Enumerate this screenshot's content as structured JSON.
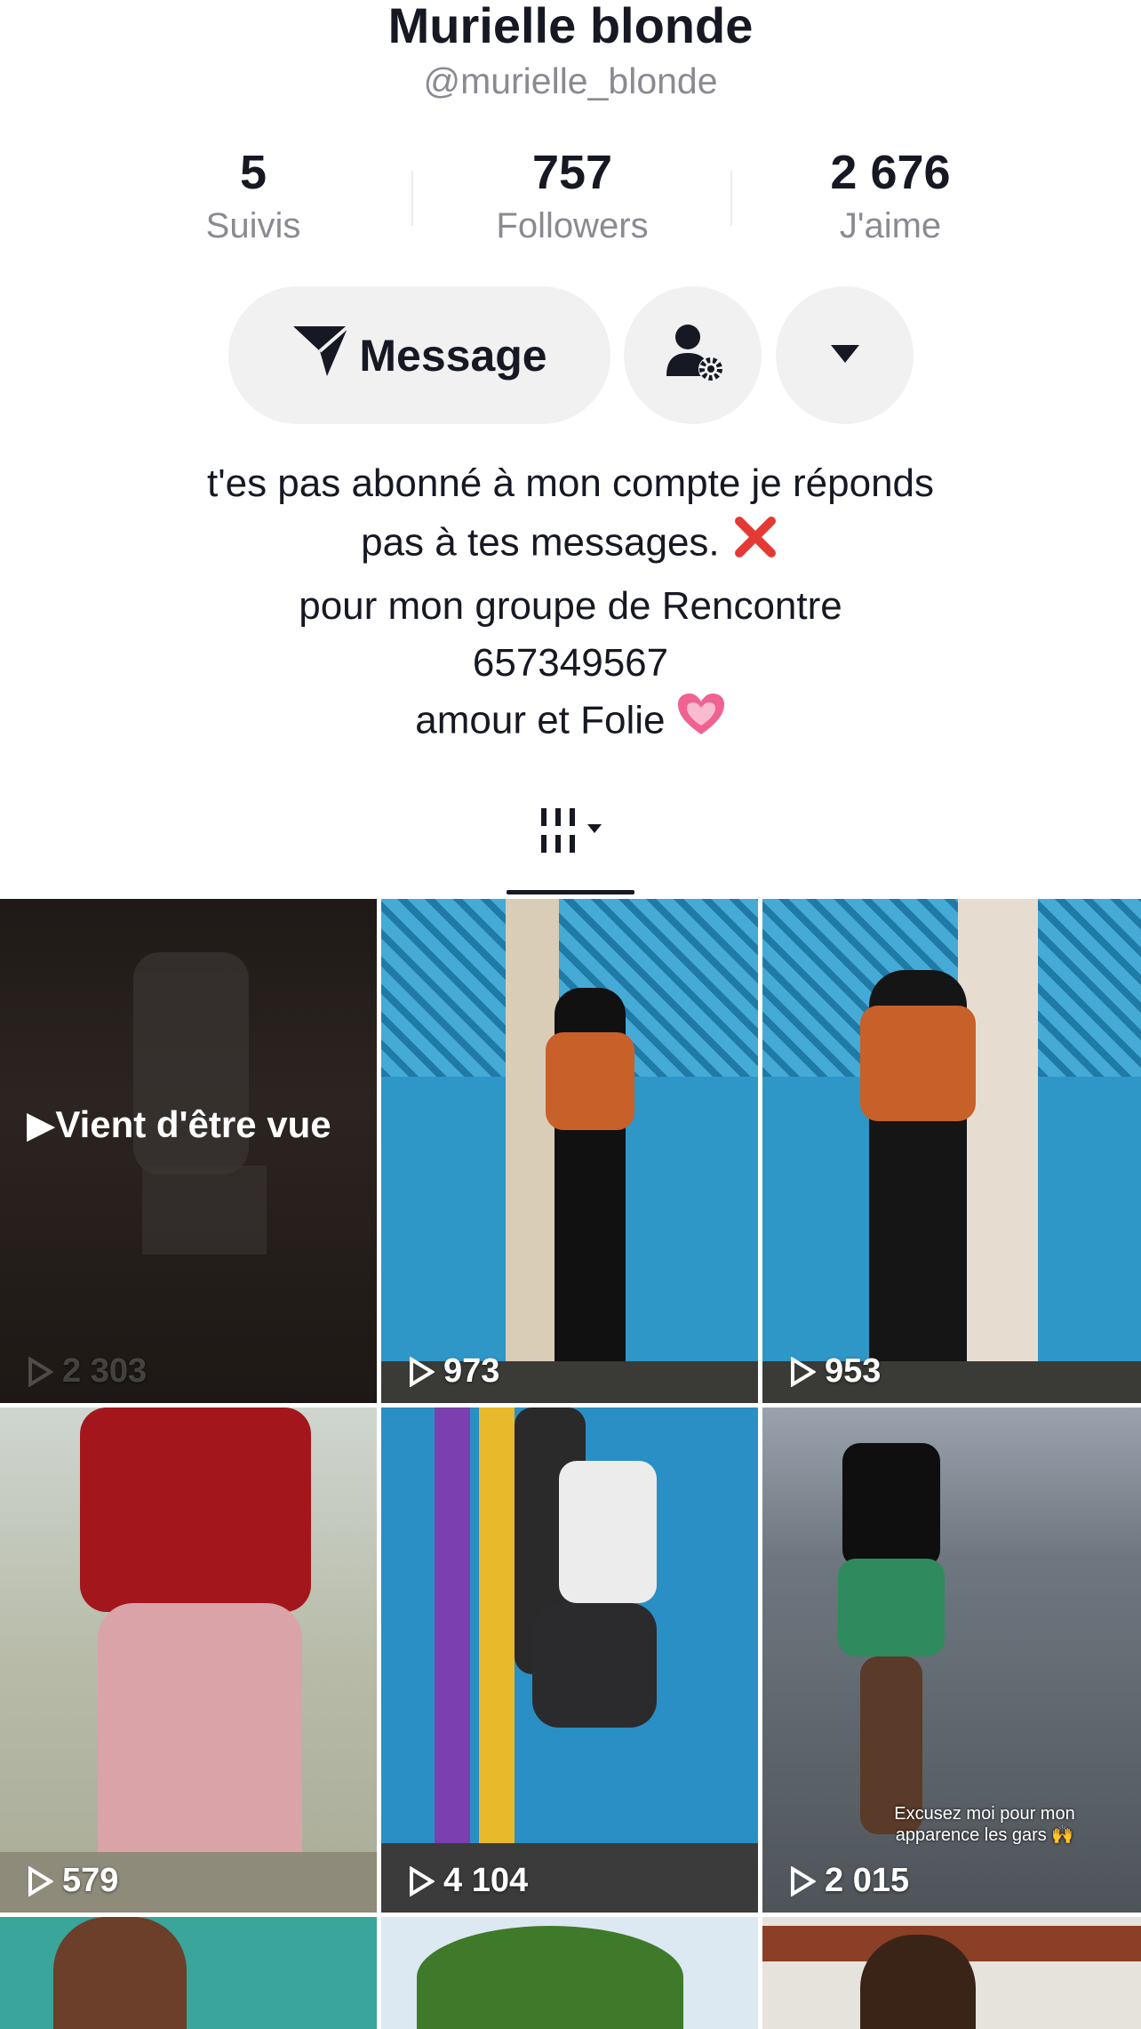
{
  "profile": {
    "name": "Murielle blonde",
    "handle": "@murielle_blonde"
  },
  "stats": [
    {
      "value": "5",
      "label": "Suivis"
    },
    {
      "value": "757",
      "label": "Followers"
    },
    {
      "value": "2 676",
      "label": "J'aime"
    }
  ],
  "actions": {
    "message_label": "Message",
    "message_icon": "send-icon",
    "profile_settings_icon": "user-gear-icon",
    "more_icon": "caret-down-icon"
  },
  "bio": {
    "line1": "t'es pas abonné à mon compte je réponds",
    "line2": "pas à tes messages.",
    "line2_emoji": "cross-mark-emoji",
    "line3": "pour mon groupe de Rencontre",
    "line4": "657349567",
    "line5": "amour et Folie",
    "line5_emoji": "growing-heart-emoji"
  },
  "tabs": {
    "videos_icon": "grid-icon"
  },
  "videos": [
    {
      "views": "2 303",
      "overlay": "Vient d'être vue",
      "caption": ""
    },
    {
      "views": "973",
      "overlay": "",
      "caption": ""
    },
    {
      "views": "953",
      "overlay": "",
      "caption": ""
    },
    {
      "views": "579",
      "overlay": "",
      "caption": ""
    },
    {
      "views": "4 104",
      "overlay": "",
      "caption": ""
    },
    {
      "views": "2 015",
      "overlay": "",
      "caption": "Excusez moi pour mon apparence les gars 🙌"
    }
  ],
  "colors": {
    "text": "#161823",
    "secondary": "#8a8b91",
    "button_bg": "#f1f1f2",
    "accent_red": "#e53935",
    "heart_pink": "#f06292"
  }
}
